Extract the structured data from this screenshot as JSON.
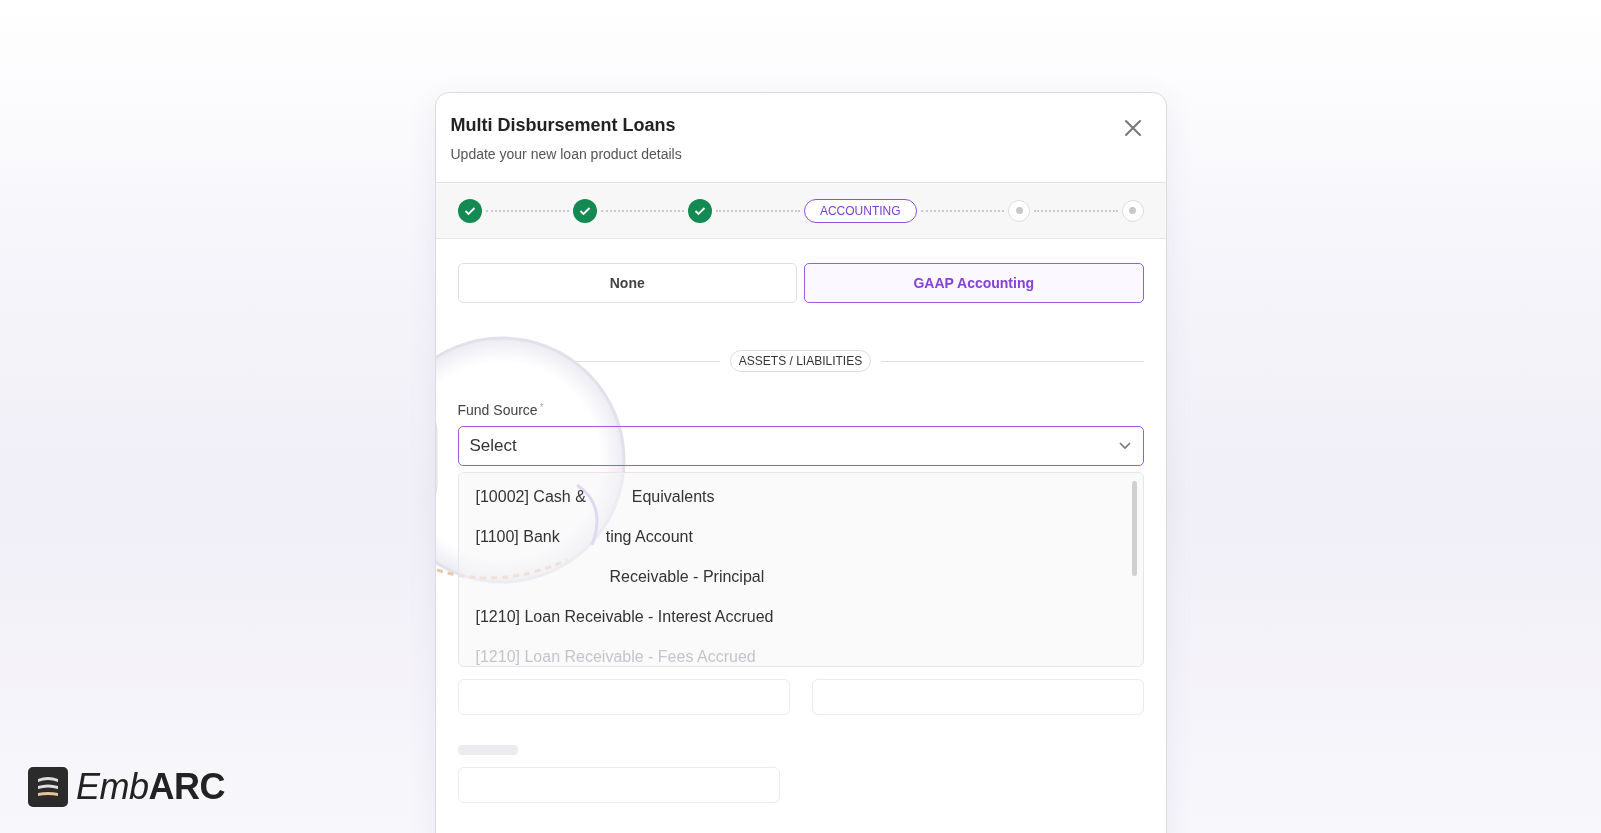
{
  "dialog": {
    "title": "Multi Disbursement Loans",
    "subtitle": "Update your new loan product details"
  },
  "steps": [
    {
      "completed": true
    },
    {
      "completed": true
    },
    {
      "completed": true
    },
    {
      "label": "ACCOUNTING"
    },
    {
      "completed": false
    },
    {
      "completed": false
    }
  ],
  "accounting_options": [
    {
      "label": "None",
      "selected": false
    },
    {
      "label": "GAAP Accounting",
      "selected": true
    }
  ],
  "section_label": "ASSETS / LIABILITIES",
  "fund_source": {
    "label": "Fund Source",
    "required_mark": "*",
    "placeholder": "Select",
    "expanded": true,
    "options": [
      {
        "before": "[10002] Cash &",
        "after": "Equivalents",
        "faded": false
      },
      {
        "before": "[1100] Bank",
        "after": "ting Account",
        "faded": false
      },
      {
        "after": "Receivable - Principal",
        "faded": false
      },
      {
        "before": "[1210] Loan Receivable - Interest Accrued",
        "faded": false
      },
      {
        "before": "[1210] Loan Receivable - Fees Accrued",
        "faded": true
      }
    ]
  },
  "brand": {
    "light": "Emb",
    "bold": "ARC"
  }
}
